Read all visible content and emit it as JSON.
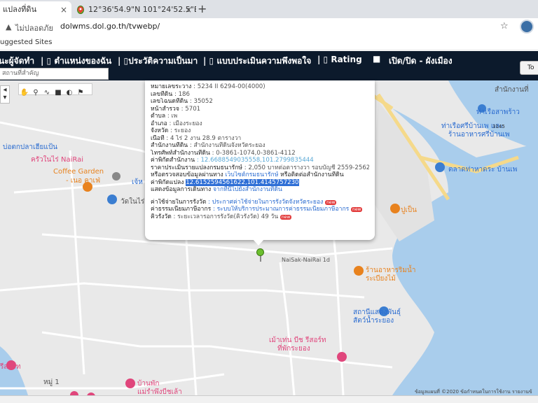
{
  "browser": {
    "active_tab": "แปลงที่ดิน",
    "inactive_tab": "12°36'54.9\"N 101°24'52.5\"E - Go",
    "new_tab_symbol": "+",
    "close_symbol": "×",
    "security_text": "ไม่ปลอดภัย",
    "url": "dolwms.dol.go.th/tvwebp/",
    "bookmarks_text": "uggested Sites"
  },
  "navbar": {
    "items": [
      "นะผู้จัดทำ",
      "| ▯ ตำแหน่งของฉัน",
      "| ▯ประวัติความเป็นมา",
      "| ▯ แบบประเมินความพึงพอใจ",
      "| ▯ Rating",
      "■",
      "เปิด/ปิด - ผังเมือง"
    ],
    "search_placeholder": "สถานที่สำคัญ",
    "top_button": "To"
  },
  "map": {
    "labels": [
      "สำนักงานที่",
      "ท่าเรือสาพร้าว",
      "ท่าเรือศรีบ้านเพ และ",
      "ร้านอาหารศรีบ้านเพ",
      "3145",
      "บ่อตกปลาเฮียแป้น",
      "ครัวในไร่ NaiRai",
      "Coffee Garden",
      "- เนอ คาเฟ่",
      "เจ้ห",
      "วัดในไร่",
      "ตลาดท่าหาดระ บ้านเพ",
      "ปูเป็น",
      "ร้านอาหารริมน้ำ",
      "ระเบียงไม้",
      "NaiSak-NaiRai 1d",
      "สถานีแสดงพันธุ์",
      "สัตว์น้ำระยอง",
      "เม้าเท่น บีช รีสอร์ท",
      "ที่พักระยอง",
      "รีสอร์ท",
      "หมู่ 1",
      "บ้านพัก",
      "แม่รำพึงบีชเล้า"
    ],
    "attribution": "ข้อมูลแผนที่ ©2020   ข้อกำหนดในการใช้งาน   รายงานข้"
  },
  "popup": {
    "rows": [
      {
        "label": "หมายเลขระวาง",
        "value": ": 5234 II 6294-00(4000)"
      },
      {
        "label": "เลขที่ดิน",
        "value": ": 186"
      },
      {
        "label": "เลขโฉนดที่ดิน",
        "value": ": 35052"
      },
      {
        "label": "หน้าสำรวจ",
        "value": ": 5701"
      },
      {
        "label": "ตำบล",
        "value": ": เพ"
      },
      {
        "label": "อำเภอ",
        "value": ": เมืองระยอง"
      },
      {
        "label": "จังหวัด",
        "value": ": ระยอง"
      },
      {
        "label": "เนื้อที่",
        "value": ": 4 ไร่ 2 งาน 28.9 ตารางวา"
      },
      {
        "label": "สำนักงานที่ดิน",
        "value": ": สำนักงานที่ดินจังหวัดระยอง"
      },
      {
        "label": "โทรศัพท์สำนักงานที่ดิน",
        "value": ": 0-3861-1074,0-3861-4112"
      },
      {
        "label": "ค่าพิกัดสำนักงาน",
        "value": ": 12.6688549035558,101.2799835444"
      },
      {
        "label": "ราคาประเมินรายแปลงกรมธนารักษ์",
        "value": ": 2,050 บาทต่อตารางวา รอบบัญชี 2559-2562"
      },
      {
        "label": "หรือตรวจสอบข้อมูลผ่านทาง",
        "value": "เว็บไซต์กรมธนารักษ์",
        "suffix": " หรือติดต่อสำนักงานที่ดิน"
      },
      {
        "label": "ค่าพิกัดแปลง",
        "value": "12.6152594561622,101.4145757230"
      },
      {
        "label": "แสดงข้อมูลการเดินทาง",
        "value": "จากที่นี่ไปยังสำนักงานที่ดิน"
      }
    ],
    "fees": [
      {
        "label": "ค่าใช้จ่ายในการรังวัด",
        "value": ": ประกาศค่าใช้จ่ายในการรังวัดจังหวัดระยอง"
      },
      {
        "label": "ค่าธรรมเนียมภาษีอากร",
        "value": ": ระบบให้บริการประมาณการค่าธรรมเนียมภาษีอากร"
      },
      {
        "label": "คิวรังวัด",
        "value": ": ระยะเวลารอการรังวัด(คิวรังวัด) 49 วัน"
      }
    ],
    "new_badge": "new"
  },
  "colors": {
    "navbar_bg": "#0c1a2c",
    "sea": "#a9cdec",
    "road": "#ffffff",
    "highway": "#f5d98a",
    "link": "#2b6cd0",
    "poi_orange": "#e8821e",
    "poi_pink": "#e0467c",
    "poi_blue": "#3b7ed1",
    "marker_green": "#6cbf2f"
  }
}
